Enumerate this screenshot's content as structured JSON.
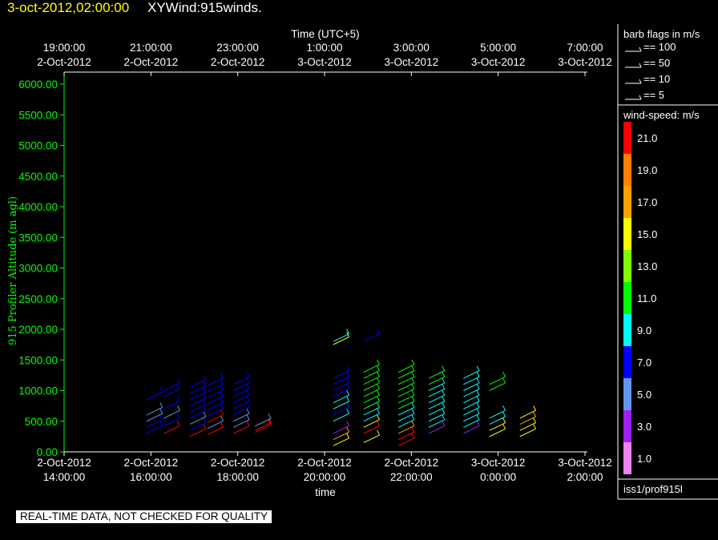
{
  "header": {
    "timestamp": "3-oct-2012,02:00:00",
    "plot_name": "XYWind:915winds."
  },
  "footer": {
    "quality_notice": "REAL-TIME DATA, NOT CHECKED FOR QUALITY"
  },
  "legend": {
    "barb_title": "barb flags in m/s",
    "barbs": [
      {
        "label": "== 100"
      },
      {
        "label": "== 50"
      },
      {
        "label": "== 10"
      },
      {
        "label": "== 5"
      }
    ],
    "speed_title": "wind-speed: m/s",
    "color_scale": [
      {
        "label": "21.0",
        "color": "#ff0000"
      },
      {
        "label": "19.0",
        "color": "#ff7f00"
      },
      {
        "label": "17.0",
        "color": "#ff9f00"
      },
      {
        "label": "15.0",
        "color": "#ffff00"
      },
      {
        "label": "13.0",
        "color": "#7fff00"
      },
      {
        "label": "11.0",
        "color": "#00ff00"
      },
      {
        "label": "9.0",
        "color": "#00ffff"
      },
      {
        "label": "7.0",
        "color": "#0000ff"
      },
      {
        "label": "5.0",
        "color": "#6495ed"
      },
      {
        "label": "3.0",
        "color": "#a020f0"
      },
      {
        "label": "1.0",
        "color": "#ee82ee"
      }
    ],
    "source": "iss1/prof915l"
  },
  "chart_data": {
    "type": "scatter",
    "xlabel": "time",
    "x2label": "Time (UTC+5)",
    "ylabel": "915 Profiler Altitude (m agl)",
    "ylim": [
      0,
      6200
    ],
    "xlim": [
      "2-Oct-2012 14:00:00",
      "3-Oct-2012 02:00:00"
    ],
    "yticks": [
      "0.00",
      "500.00",
      "1000.00",
      "1500.00",
      "2000.00",
      "2500.00",
      "3000.00",
      "3500.00",
      "4000.00",
      "4500.00",
      "5000.00",
      "5500.00",
      "6000.00"
    ],
    "xticks_bottom": [
      {
        "date": "2-Oct-2012",
        "time": "14:00:00"
      },
      {
        "date": "2-Oct-2012",
        "time": "16:00:00"
      },
      {
        "date": "2-Oct-2012",
        "time": "18:00:00"
      },
      {
        "date": "2-Oct-2012",
        "time": "20:00:00"
      },
      {
        "date": "2-Oct-2012",
        "time": "22:00:00"
      },
      {
        "date": "3-Oct-2012",
        "time": "0:00:00"
      },
      {
        "date": "3-Oct-2012",
        "time": "2:00:00"
      }
    ],
    "xticks_top": [
      {
        "time": "19:00:00",
        "date": "2-Oct-2012"
      },
      {
        "time": "21:00:00",
        "date": "2-Oct-2012"
      },
      {
        "time": "23:00:00",
        "date": "2-Oct-2012"
      },
      {
        "time": "1:00:00",
        "date": "3-Oct-2012"
      },
      {
        "time": "3:00:00",
        "date": "3-Oct-2012"
      },
      {
        "time": "5:00:00",
        "date": "3-Oct-2012"
      },
      {
        "time": "7:00:00",
        "date": "3-Oct-2012"
      }
    ],
    "series": [
      {
        "hour": 15.9,
        "altitudes": [
          300,
          400,
          500,
          600,
          850
        ],
        "speeds": [
          6,
          6,
          5,
          4,
          7
        ]
      },
      {
        "hour": 16.3,
        "altitudes": [
          300,
          420,
          550,
          700,
          900,
          1000
        ],
        "speeds": [
          21,
          6,
          5,
          7,
          7,
          7
        ]
      },
      {
        "hour": 16.9,
        "altitudes": [
          250,
          350,
          450,
          550,
          650,
          750,
          850,
          950,
          1050
        ],
        "speeds": [
          21,
          6,
          4,
          7,
          7,
          7,
          7,
          7,
          7
        ]
      },
      {
        "hour": 17.3,
        "altitudes": [
          280,
          380,
          480,
          580,
          680,
          780,
          880,
          980,
          1080
        ],
        "speeds": [
          21,
          5,
          21,
          7,
          7,
          7,
          7,
          7,
          7
        ]
      },
      {
        "hour": 17.9,
        "altitudes": [
          300,
          400,
          500,
          600,
          700,
          800,
          900,
          1000,
          1100
        ],
        "speeds": [
          21,
          5,
          5,
          7,
          7,
          7,
          7,
          7,
          7
        ]
      },
      {
        "hour": 18.4,
        "altitudes": [
          320,
          350,
          420
        ],
        "speeds": [
          21,
          21,
          5
        ]
      },
      {
        "hour": 20.2,
        "altitudes": [
          100,
          200,
          300,
          500,
          600,
          700,
          800,
          900,
          1000,
          1100,
          1200,
          1750,
          1800
        ],
        "speeds": [
          15,
          17,
          3,
          9,
          7,
          9,
          9,
          7,
          7,
          7,
          7,
          15,
          9
        ]
      },
      {
        "hour": 20.9,
        "altitudes": [
          150,
          300,
          400,
          500,
          600,
          700,
          800,
          900,
          1000,
          1100,
          1200,
          1300,
          1800
        ],
        "speeds": [
          15,
          21,
          15,
          9,
          9,
          11,
          11,
          11,
          11,
          11,
          11,
          11,
          7
        ]
      },
      {
        "hour": 21.7,
        "altitudes": [
          100,
          200,
          300,
          400,
          500,
          600,
          700,
          800,
          900,
          1000,
          1100,
          1200,
          1300
        ],
        "speeds": [
          21,
          21,
          17,
          9,
          9,
          9,
          11,
          11,
          11,
          11,
          11,
          11,
          11
        ]
      },
      {
        "hour": 22.4,
        "altitudes": [
          300,
          400,
          500,
          600,
          700,
          800,
          900,
          1000,
          1100,
          1200
        ],
        "speeds": [
          3,
          9,
          9,
          9,
          9,
          9,
          9,
          9,
          11,
          11
        ]
      },
      {
        "hour": 23.2,
        "altitudes": [
          300,
          400,
          500,
          600,
          700,
          800,
          900,
          1000,
          1100,
          1200
        ],
        "speeds": [
          3,
          9,
          9,
          9,
          9,
          9,
          9,
          9,
          9,
          9
        ]
      },
      {
        "hour": 23.8,
        "altitudes": [
          250,
          350,
          450,
          550,
          1000,
          1100
        ],
        "speeds": [
          15,
          15,
          9,
          9,
          11,
          11
        ]
      },
      {
        "hour": 24.5,
        "altitudes": [
          250,
          350,
          450,
          550
        ],
        "speeds": [
          15,
          15,
          17,
          15
        ]
      }
    ]
  }
}
